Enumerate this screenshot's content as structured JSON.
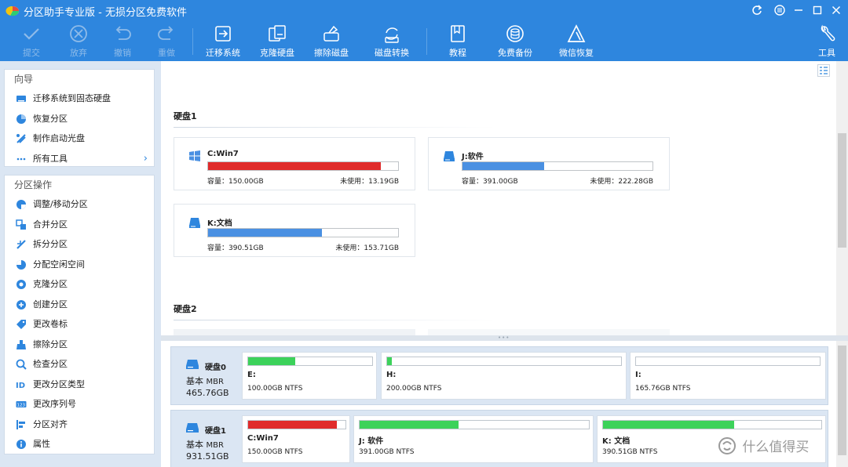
{
  "window": {
    "title": "分区助手专业版 - 无损分区免费软件"
  },
  "toolbar": {
    "submit": "提交",
    "discard": "放弃",
    "undo": "撤销",
    "redo": "重做",
    "migrate_os": "迁移系统",
    "clone_disk": "克隆硬盘",
    "wipe_disk": "擦除磁盘",
    "disk_convert": "磁盘转换",
    "tutorial": "教程",
    "free_backup": "免费备份",
    "wechat_restore": "微信恢复",
    "tools": "工具"
  },
  "sidebar": {
    "wizard_title": "向导",
    "wizard_items": [
      {
        "label": "迁移系统到固态硬盘",
        "icon": "migrate-ssd-icon"
      },
      {
        "label": "恢复分区",
        "icon": "recover-partition-icon"
      },
      {
        "label": "制作启动光盘",
        "icon": "bootable-media-icon"
      },
      {
        "label": "所有工具",
        "icon": "all-tools-icon"
      }
    ],
    "ops_title": "分区操作",
    "ops_items": [
      {
        "label": "调整/移动分区",
        "icon": "resize-icon"
      },
      {
        "label": "合并分区",
        "icon": "merge-icon"
      },
      {
        "label": "拆分分区",
        "icon": "split-icon"
      },
      {
        "label": "分配空闲空间",
        "icon": "allocate-icon"
      },
      {
        "label": "克隆分区",
        "icon": "clone-icon"
      },
      {
        "label": "创建分区",
        "icon": "create-icon"
      },
      {
        "label": "更改卷标",
        "icon": "label-icon"
      },
      {
        "label": "擦除分区",
        "icon": "wipe-icon"
      },
      {
        "label": "检查分区",
        "icon": "check-icon"
      },
      {
        "label": "更改分区类型",
        "icon": "id-icon"
      },
      {
        "label": "更改序列号",
        "icon": "serial-icon"
      },
      {
        "label": "分区对齐",
        "icon": "align-icon"
      },
      {
        "label": "属性",
        "icon": "info-icon"
      }
    ]
  },
  "main": {
    "disk1_heading": "硬盘1",
    "disk2_heading": "硬盘2",
    "cards": [
      {
        "name": "C:Win7",
        "capacity": "容量：150.00GB",
        "free": "未使用：13.19GB",
        "used_fraction": 0.91,
        "color": "#e02b2b",
        "icon": "windows-icon"
      },
      {
        "name": "J:软件",
        "capacity": "容量：391.00GB",
        "free": "未使用：222.28GB",
        "used_fraction": 0.43,
        "color": "#4a90e2",
        "icon": "drive-icon"
      },
      {
        "name": "K:文档",
        "capacity": "容量：390.51GB",
        "free": "未使用：153.71GB",
        "used_fraction": 0.6,
        "color": "#4a90e2",
        "icon": "drive-icon"
      }
    ]
  },
  "diskmap": {
    "disks": [
      {
        "name": "硬盘0",
        "type": "基本",
        "style": "MBR",
        "size": "465.76GB",
        "partitions": [
          {
            "name": "E:",
            "info": "100.00GB NTFS",
            "used_fraction": 0.38,
            "color": "#3cd25a"
          },
          {
            "name": "H:",
            "info": "200.00GB NTFS",
            "used_fraction": 0.02,
            "color": "#3cd25a"
          },
          {
            "name": "I:",
            "info": "165.76GB NTFS",
            "used_fraction": 0.0,
            "color": "#3cd25a"
          }
        ]
      },
      {
        "name": "硬盘1",
        "type": "基本",
        "style": "MBR",
        "size": "931.51GB",
        "partitions": [
          {
            "name": "C:Win7",
            "info": "150.00GB NTFS",
            "used_fraction": 0.91,
            "color": "#e02b2b"
          },
          {
            "name": "J: 软件",
            "info": "391.00GB NTFS",
            "used_fraction": 0.43,
            "color": "#3cd25a"
          },
          {
            "name": "K: 文档",
            "info": "390.51GB NTFS",
            "used_fraction": 0.6,
            "color": "#3cd25a"
          }
        ]
      }
    ]
  },
  "watermark": {
    "text": "什么值得买"
  },
  "colors": {
    "titlebar": "#2e86de",
    "accent": "#4a90e2",
    "used_red": "#e02b2b",
    "used_green": "#3cd25a"
  }
}
